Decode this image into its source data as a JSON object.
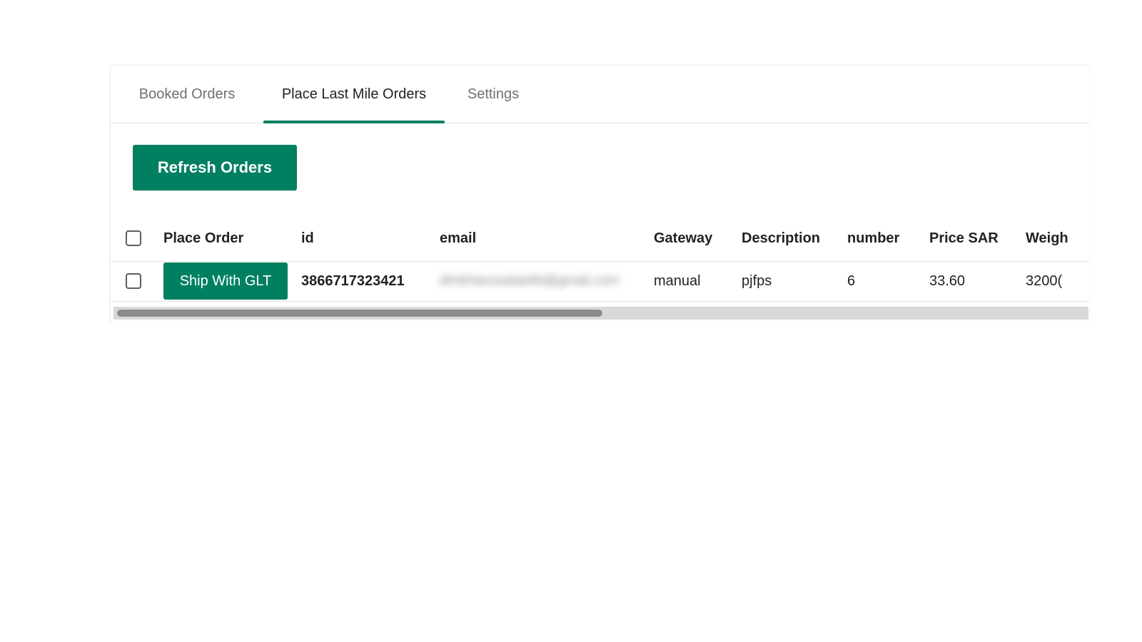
{
  "tabs": [
    {
      "label": "Booked Orders",
      "active": false
    },
    {
      "label": "Place Last Mile Orders",
      "active": true
    },
    {
      "label": "Settings",
      "active": false
    }
  ],
  "toolbar": {
    "refresh_label": "Refresh Orders"
  },
  "table": {
    "columns": [
      "Place Order",
      "id",
      "email",
      "Gateway",
      "Description",
      "number",
      "Price SAR",
      "Weigh"
    ],
    "rows": [
      {
        "action_label": "Ship With GLT",
        "id": "3866717323421",
        "email": "dimkhaussaiaelbl@gmail.com",
        "gateway": "manual",
        "description": "pjfps",
        "number": "6",
        "price": "33.60",
        "weight": "3200("
      }
    ]
  },
  "colors": {
    "accent": "#008060",
    "text": "#202223",
    "muted_text": "#6d7175",
    "border": "#e1e3e5"
  }
}
